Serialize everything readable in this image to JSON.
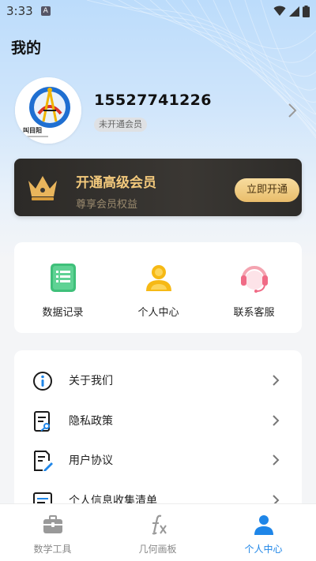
{
  "status_bar": {
    "time": "3:33",
    "notification_letter": "A",
    "icons": [
      "wifi-icon",
      "signal-icon",
      "battery-icon"
    ]
  },
  "page": {
    "title": "我的"
  },
  "profile": {
    "phone": "15527741226",
    "membership_status": "未开通会员",
    "avatar_caption": "叫目阳"
  },
  "vip": {
    "title": "开通高级会员",
    "subtitle": "尊享会员权益",
    "button_label": "立即开通",
    "accent_color": "#f3c97c"
  },
  "quick_actions": [
    {
      "label": "数据记录",
      "icon": "data-record-icon"
    },
    {
      "label": "个人中心",
      "icon": "user-center-icon"
    },
    {
      "label": "联系客服",
      "icon": "customer-service-icon"
    }
  ],
  "menu": [
    {
      "label": "关于我们",
      "icon": "info-icon"
    },
    {
      "label": "隐私政策",
      "icon": "privacy-policy-icon"
    },
    {
      "label": "用户协议",
      "icon": "user-agreement-icon"
    },
    {
      "label": "个人信息收集清单",
      "icon": "list-icon"
    }
  ],
  "tabbar": {
    "tabs": [
      {
        "label": "数学工具",
        "icon": "toolbox-icon",
        "active": false
      },
      {
        "label": "几何画板",
        "icon": "function-fx-icon",
        "active": false
      },
      {
        "label": "个人中心",
        "icon": "person-icon",
        "active": true
      }
    ],
    "active_color": "#1f86e8"
  }
}
